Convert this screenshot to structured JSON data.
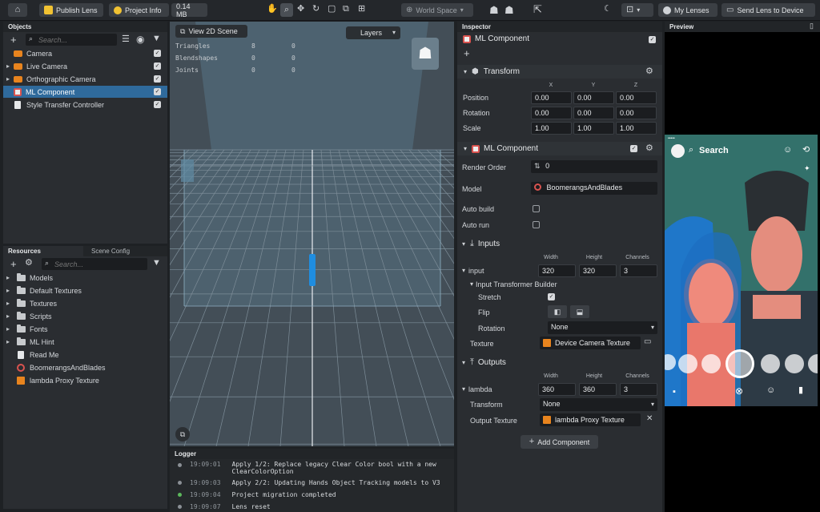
{
  "toolbar": {
    "publish_label": "Publish Lens",
    "project_info_label": "Project Info",
    "size_label": "0.14 MB",
    "world_space_label": "World Space",
    "my_lenses_label": "My Lenses",
    "send_lens_label": "Send Lens to Device"
  },
  "objects": {
    "title": "Objects",
    "search_placeholder": "Search...",
    "items": [
      {
        "label": "Camera"
      },
      {
        "label": "Live Camera"
      },
      {
        "label": "Orthographic Camera"
      },
      {
        "label": "ML Component"
      },
      {
        "label": "Style Transfer Controller"
      }
    ]
  },
  "resources": {
    "tab_resources": "Resources",
    "tab_scene_config": "Scene Config",
    "search_placeholder": "Search...",
    "items": [
      {
        "label": "Models"
      },
      {
        "label": "Default Textures"
      },
      {
        "label": "Textures"
      },
      {
        "label": "Scripts"
      },
      {
        "label": "Fonts"
      },
      {
        "label": "ML Hint"
      },
      {
        "label": "Read Me"
      },
      {
        "label": "BoomerangsAndBlades"
      },
      {
        "label": "lambda Proxy Texture"
      }
    ]
  },
  "scene": {
    "view2d_label": "View 2D Scene",
    "layers_label": "Layers",
    "stats": [
      {
        "name": "Triangles",
        "a": "8",
        "b": "0"
      },
      {
        "name": "Blendshapes",
        "a": "0",
        "b": "0"
      },
      {
        "name": "Joints",
        "a": "0",
        "b": "0"
      }
    ]
  },
  "logger": {
    "title": "Logger",
    "entries": [
      {
        "time": "19:09:01",
        "text": "Apply 1/2: Replace legacy Clear Color bool with a new",
        "text2": "ClearColorOption"
      },
      {
        "time": "19:09:03",
        "text": "Apply 2/2: Updating Hands Object Tracking models to V3"
      },
      {
        "time": "19:09:04",
        "text": "Project migration completed"
      },
      {
        "time": "19:09:07",
        "text": "Lens reset"
      }
    ]
  },
  "inspector": {
    "title": "Inspector",
    "object_name": "ML Component",
    "transform": {
      "title": "Transform",
      "axes": [
        "X",
        "Y",
        "Z"
      ],
      "position_label": "Position",
      "position": [
        "0.00",
        "0.00",
        "0.00"
      ],
      "rotation_label": "Rotation",
      "rotation": [
        "0.00",
        "0.00",
        "0.00"
      ],
      "scale_label": "Scale",
      "scale": [
        "1.00",
        "1.00",
        "1.00"
      ]
    },
    "ml": {
      "title": "ML Component",
      "render_order_label": "Render Order",
      "render_order": "0",
      "model_label": "Model",
      "model": "BoomerangsAndBlades",
      "auto_build_label": "Auto build",
      "auto_run_label": "Auto run"
    },
    "inputs": {
      "title": "Inputs",
      "width_label": "Width",
      "height_label": "Height",
      "channels_label": "Channels",
      "name": "input",
      "width": "320",
      "height": "320",
      "channels": "3",
      "builder_label": "Input Transformer Builder",
      "stretch_label": "Stretch",
      "flip_label": "Flip",
      "rotation_label": "Rotation",
      "rotation_value": "None",
      "texture_label": "Texture",
      "texture_value": "Device Camera Texture"
    },
    "outputs": {
      "title": "Outputs",
      "width_label": "Width",
      "height_label": "Height",
      "channels_label": "Channels",
      "name": "lambda",
      "width": "360",
      "height": "360",
      "channels": "3",
      "transform_label": "Transform",
      "transform_value": "None",
      "output_texture_label": "Output Texture",
      "output_texture_value": "lambda Proxy Texture"
    },
    "add_component_label": "Add Component"
  },
  "preview": {
    "title": "Preview",
    "search_label": "Search"
  },
  "colors": {
    "selection": "#2f6a9c",
    "accent": "#f1c232",
    "viewport": "#4b5a66"
  }
}
